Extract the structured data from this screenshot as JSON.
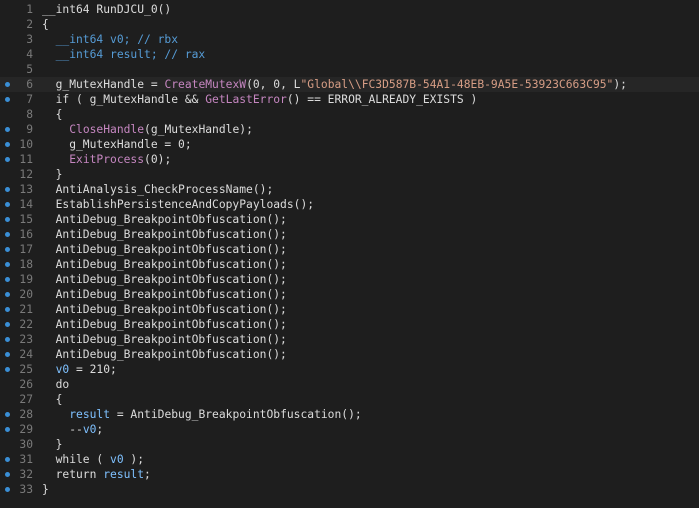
{
  "lines": [
    {
      "n": "1",
      "bp": false,
      "hl": false,
      "tokens": [
        {
          "t": "__int64 RunDJCU_0()",
          "c": "pl"
        }
      ]
    },
    {
      "n": "2",
      "bp": false,
      "hl": false,
      "tokens": [
        {
          "t": "{",
          "c": "pl"
        }
      ]
    },
    {
      "n": "3",
      "bp": false,
      "hl": false,
      "tokens": [
        {
          "t": "  __int64 v0; // rbx",
          "c": "cm"
        }
      ]
    },
    {
      "n": "4",
      "bp": false,
      "hl": false,
      "tokens": [
        {
          "t": "  __int64 result; // rax",
          "c": "cm"
        }
      ]
    },
    {
      "n": "5",
      "bp": false,
      "hl": false,
      "tokens": []
    },
    {
      "n": "6",
      "bp": true,
      "hl": true,
      "tokens": [
        {
          "t": "  g_MutexHandle = ",
          "c": "pl"
        },
        {
          "t": "CreateMutexW",
          "c": "fn"
        },
        {
          "t": "(0, 0, L",
          "c": "pl"
        },
        {
          "t": "\"Global\\\\FC3D587B-54A1-48EB-9A5E-53923C663C95\"",
          "c": "str"
        },
        {
          "t": ");",
          "c": "pl"
        }
      ]
    },
    {
      "n": "7",
      "bp": true,
      "hl": false,
      "tokens": [
        {
          "t": "  if ( g_MutexHandle && ",
          "c": "pl"
        },
        {
          "t": "GetLastError",
          "c": "fn"
        },
        {
          "t": "() == ERROR_ALREADY_EXISTS )",
          "c": "pl"
        }
      ]
    },
    {
      "n": "8",
      "bp": false,
      "hl": false,
      "tokens": [
        {
          "t": "  {",
          "c": "pl"
        }
      ]
    },
    {
      "n": "9",
      "bp": true,
      "hl": false,
      "tokens": [
        {
          "t": "    ",
          "c": "pl"
        },
        {
          "t": "CloseHandle",
          "c": "fn"
        },
        {
          "t": "(g_MutexHandle);",
          "c": "pl"
        }
      ]
    },
    {
      "n": "10",
      "bp": true,
      "hl": false,
      "tokens": [
        {
          "t": "    g_MutexHandle = 0;",
          "c": "pl"
        }
      ]
    },
    {
      "n": "11",
      "bp": true,
      "hl": false,
      "tokens": [
        {
          "t": "    ",
          "c": "pl"
        },
        {
          "t": "ExitProcess",
          "c": "fn"
        },
        {
          "t": "(0);",
          "c": "pl"
        }
      ]
    },
    {
      "n": "12",
      "bp": false,
      "hl": false,
      "tokens": [
        {
          "t": "  }",
          "c": "pl"
        }
      ]
    },
    {
      "n": "13",
      "bp": true,
      "hl": false,
      "tokens": [
        {
          "t": "  AntiAnalysis_CheckProcessName();",
          "c": "pl"
        }
      ]
    },
    {
      "n": "14",
      "bp": true,
      "hl": false,
      "tokens": [
        {
          "t": "  EstablishPersistenceAndCopyPayloads();",
          "c": "pl"
        }
      ]
    },
    {
      "n": "15",
      "bp": true,
      "hl": false,
      "tokens": [
        {
          "t": "  AntiDebug_BreakpointObfuscation();",
          "c": "pl"
        }
      ]
    },
    {
      "n": "16",
      "bp": true,
      "hl": false,
      "tokens": [
        {
          "t": "  AntiDebug_BreakpointObfuscation();",
          "c": "pl"
        }
      ]
    },
    {
      "n": "17",
      "bp": true,
      "hl": false,
      "tokens": [
        {
          "t": "  AntiDebug_BreakpointObfuscation();",
          "c": "pl"
        }
      ]
    },
    {
      "n": "18",
      "bp": true,
      "hl": false,
      "tokens": [
        {
          "t": "  AntiDebug_BreakpointObfuscation();",
          "c": "pl"
        }
      ]
    },
    {
      "n": "19",
      "bp": true,
      "hl": false,
      "tokens": [
        {
          "t": "  AntiDebug_BreakpointObfuscation();",
          "c": "pl"
        }
      ]
    },
    {
      "n": "20",
      "bp": true,
      "hl": false,
      "tokens": [
        {
          "t": "  AntiDebug_BreakpointObfuscation();",
          "c": "pl"
        }
      ]
    },
    {
      "n": "21",
      "bp": true,
      "hl": false,
      "tokens": [
        {
          "t": "  AntiDebug_BreakpointObfuscation();",
          "c": "pl"
        }
      ]
    },
    {
      "n": "22",
      "bp": true,
      "hl": false,
      "tokens": [
        {
          "t": "  AntiDebug_BreakpointObfuscation();",
          "c": "pl"
        }
      ]
    },
    {
      "n": "23",
      "bp": true,
      "hl": false,
      "tokens": [
        {
          "t": "  AntiDebug_BreakpointObfuscation();",
          "c": "pl"
        }
      ]
    },
    {
      "n": "24",
      "bp": true,
      "hl": false,
      "tokens": [
        {
          "t": "  AntiDebug_BreakpointObfuscation();",
          "c": "pl"
        }
      ]
    },
    {
      "n": "25",
      "bp": true,
      "hl": false,
      "tokens": [
        {
          "t": "  ",
          "c": "pl"
        },
        {
          "t": "v0",
          "c": "ref"
        },
        {
          "t": " = 210;",
          "c": "pl"
        }
      ]
    },
    {
      "n": "26",
      "bp": false,
      "hl": false,
      "tokens": [
        {
          "t": "  do",
          "c": "pl"
        }
      ]
    },
    {
      "n": "27",
      "bp": false,
      "hl": false,
      "tokens": [
        {
          "t": "  {",
          "c": "pl"
        }
      ]
    },
    {
      "n": "28",
      "bp": true,
      "hl": false,
      "tokens": [
        {
          "t": "    ",
          "c": "pl"
        },
        {
          "t": "result",
          "c": "ref"
        },
        {
          "t": " = AntiDebug_BreakpointObfuscation();",
          "c": "pl"
        }
      ]
    },
    {
      "n": "29",
      "bp": true,
      "hl": false,
      "tokens": [
        {
          "t": "    --",
          "c": "pl"
        },
        {
          "t": "v0",
          "c": "ref"
        },
        {
          "t": ";",
          "c": "pl"
        }
      ]
    },
    {
      "n": "30",
      "bp": false,
      "hl": false,
      "tokens": [
        {
          "t": "  }",
          "c": "pl"
        }
      ]
    },
    {
      "n": "31",
      "bp": true,
      "hl": false,
      "tokens": [
        {
          "t": "  while ( ",
          "c": "pl"
        },
        {
          "t": "v0",
          "c": "ref"
        },
        {
          "t": " );",
          "c": "pl"
        }
      ]
    },
    {
      "n": "32",
      "bp": true,
      "hl": false,
      "tokens": [
        {
          "t": "  return ",
          "c": "pl"
        },
        {
          "t": "result",
          "c": "ref"
        },
        {
          "t": ";",
          "c": "pl"
        }
      ]
    },
    {
      "n": "33",
      "bp": true,
      "hl": false,
      "tokens": [
        {
          "t": "}",
          "c": "pl"
        }
      ]
    }
  ],
  "colors": {
    "background": "#1e1e1e",
    "highlight_line": "#262626",
    "breakpoint_dot": "#3a8fd6",
    "line_number": "#7a7a7a",
    "plain_text": "#dcdcdc",
    "comment": "#569cd6",
    "api_function": "#c586c0",
    "string_literal": "#d69d85",
    "local_variable": "#7fc1ff"
  },
  "icons": {
    "breakpoint": "breakpoint-dot-icon"
  }
}
